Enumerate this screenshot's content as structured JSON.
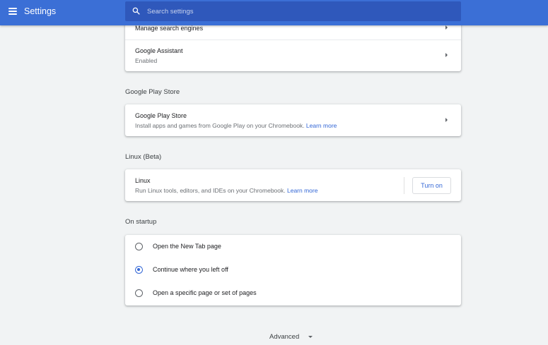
{
  "header": {
    "title": "Settings",
    "menu_icon": "hamburger-menu-icon",
    "search_icon": "search-icon",
    "search_placeholder": "Search settings",
    "accent_color": "#3b6fd6"
  },
  "search_engine_card": {
    "manage_label": "Manage search engines",
    "assistant_label": "Google Assistant",
    "assistant_status": "Enabled"
  },
  "play_store": {
    "section_title": "Google Play Store",
    "item_label": "Google Play Store",
    "item_description": "Install apps and games from Google Play on your Chromebook.",
    "learn_more": "Learn more"
  },
  "linux": {
    "section_title": "Linux (Beta)",
    "item_label": "Linux",
    "item_description": "Run Linux tools, editors, and IDEs on your Chromebook.",
    "learn_more": "Learn more",
    "turn_on_label": "Turn on"
  },
  "startup": {
    "section_title": "On startup",
    "selected": "Continue where you left off",
    "options": [
      "Open the New Tab page",
      "Continue where you left off",
      "Open a specific page or set of pages"
    ]
  },
  "footer": {
    "advanced_label": "Advanced",
    "advanced_icon": "chevron-down-icon"
  },
  "link_color": "#3367d6"
}
